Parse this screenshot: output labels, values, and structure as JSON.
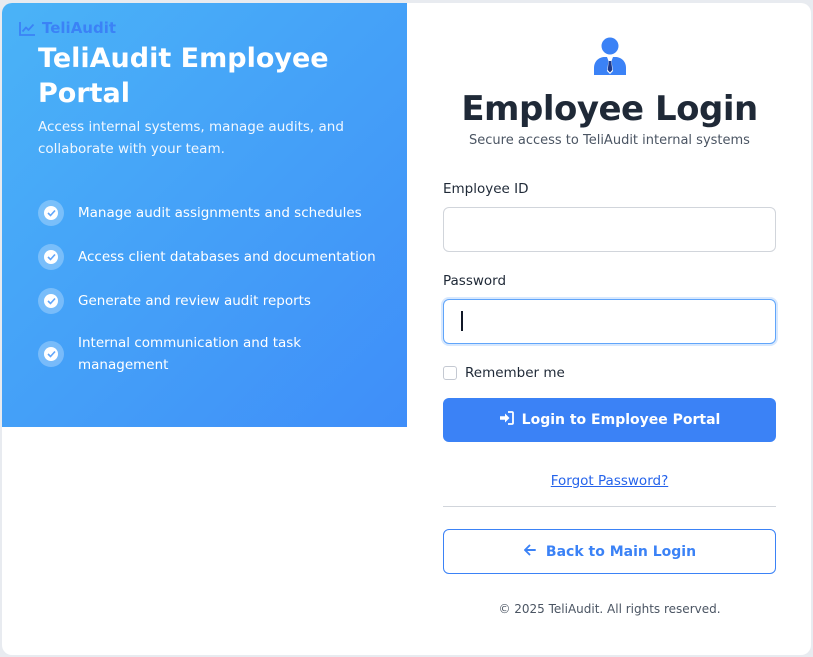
{
  "brand": {
    "name": "TeliAudit",
    "icon": "chart-line-icon",
    "color": "#3b82f6"
  },
  "hero": {
    "title": "TeliAudit Employee Portal",
    "description": "Access internal systems, manage audits, and collaborate with your team.",
    "gradient": [
      "#4ab3f7",
      "#3f8ef9"
    ],
    "features": [
      {
        "label": "Manage audit assignments and schedules",
        "icon": "check-circle-icon"
      },
      {
        "label": "Access client databases and documentation",
        "icon": "check-circle-icon"
      },
      {
        "label": "Generate and review audit reports",
        "icon": "check-circle-icon"
      },
      {
        "label": "Internal communication and task management",
        "icon": "check-circle-icon"
      }
    ]
  },
  "login": {
    "icon": "user-tie-icon",
    "title": "Employee Login",
    "subtitle": "Secure access to TeliAudit internal systems",
    "employee_id": {
      "label": "Employee ID",
      "value": "",
      "placeholder": ""
    },
    "password": {
      "label": "Password",
      "value": "",
      "placeholder": ""
    },
    "remember_label": "Remember me",
    "submit_label": "Login to Employee Portal",
    "submit_icon": "sign-in-icon",
    "forgot_label": "Forgot Password?",
    "back_label": "Back to Main Login",
    "back_icon": "arrow-left-icon",
    "copyright": "© 2025 TeliAudit. All rights reserved."
  },
  "colors": {
    "accent": "#3b82f6",
    "text": "#1f2937",
    "muted": "#4b5563"
  }
}
